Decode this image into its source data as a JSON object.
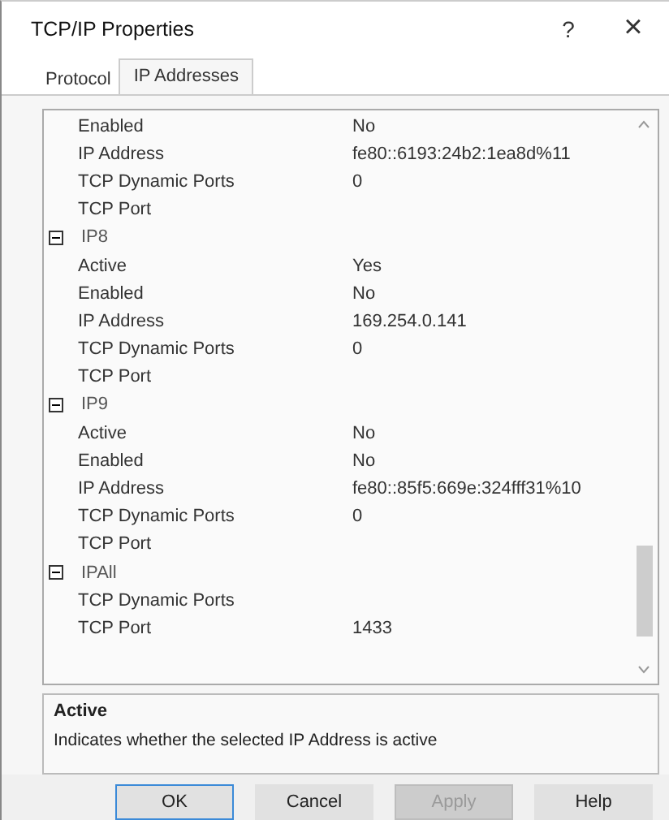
{
  "window": {
    "title": "TCP/IP Properties",
    "help_button": "?",
    "close_button": "×"
  },
  "tabs": [
    {
      "label": "Protocol",
      "selected": false
    },
    {
      "label": "IP Addresses",
      "selected": true
    }
  ],
  "grid": {
    "groups": [
      {
        "rows": [
          {
            "name": "Enabled",
            "value": "No"
          },
          {
            "name": "IP Address",
            "value": "fe80::6193:24b2:1ea8d%11"
          },
          {
            "name": "TCP Dynamic Ports",
            "value": "0"
          },
          {
            "name": "TCP Port",
            "value": ""
          }
        ]
      },
      {
        "title": "IP8",
        "expanded": true,
        "rows": [
          {
            "name": "Active",
            "value": "Yes"
          },
          {
            "name": "Enabled",
            "value": "No"
          },
          {
            "name": "IP Address",
            "value": "169.254.0.141"
          },
          {
            "name": "TCP Dynamic Ports",
            "value": "0"
          },
          {
            "name": "TCP Port",
            "value": ""
          }
        ]
      },
      {
        "title": "IP9",
        "expanded": true,
        "rows": [
          {
            "name": "Active",
            "value": "No"
          },
          {
            "name": "Enabled",
            "value": "No"
          },
          {
            "name": "IP Address",
            "value": "fe80::85f5:669e:324fff31%10"
          },
          {
            "name": "TCP Dynamic Ports",
            "value": "0"
          },
          {
            "name": "TCP Port",
            "value": ""
          }
        ]
      },
      {
        "title": "IPAll",
        "expanded": true,
        "rows": [
          {
            "name": "TCP Dynamic Ports",
            "value": ""
          },
          {
            "name": "TCP Port",
            "value": "1433"
          }
        ]
      }
    ]
  },
  "description": {
    "title": "Active",
    "text": "Indicates whether the selected IP Address is active"
  },
  "buttons": [
    {
      "label": "OK",
      "disabled": false,
      "default": true
    },
    {
      "label": "Cancel",
      "disabled": false,
      "default": false
    },
    {
      "label": "Apply",
      "disabled": true,
      "default": false
    },
    {
      "label": "Help",
      "disabled": false,
      "default": false
    }
  ]
}
